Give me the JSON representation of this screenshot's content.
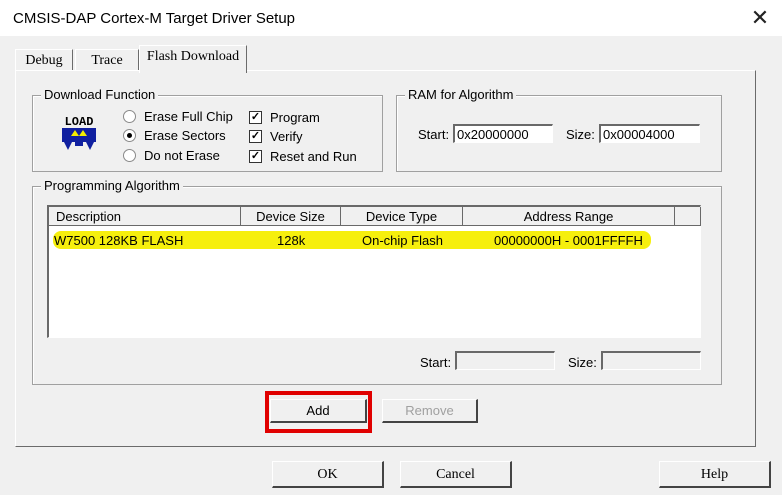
{
  "window": {
    "title": "CMSIS-DAP Cortex-M Target Driver Setup",
    "close_glyph": "✕"
  },
  "tabs": [
    {
      "label": "Debug"
    },
    {
      "label": "Trace"
    },
    {
      "label": "Flash Download",
      "active": true
    }
  ],
  "download_function": {
    "legend": "Download Function",
    "icon": "load-icon",
    "radios": [
      {
        "label": "Erase Full Chip",
        "checked": false
      },
      {
        "label": "Erase Sectors",
        "checked": true
      },
      {
        "label": "Do not Erase",
        "checked": false
      }
    ],
    "checks": [
      {
        "label": "Program",
        "checked": true
      },
      {
        "label": "Verify",
        "checked": true
      },
      {
        "label": "Reset and Run",
        "checked": true
      }
    ]
  },
  "ram": {
    "legend": "RAM for Algorithm",
    "start_label": "Start:",
    "start_value": "0x20000000",
    "size_label": "Size:",
    "size_value": "0x00004000"
  },
  "programming": {
    "legend": "Programming Algorithm",
    "columns": [
      "Description",
      "Device Size",
      "Device Type",
      "Address Range"
    ],
    "rows": [
      {
        "description": "W7500 128KB FLASH",
        "size": "128k",
        "type": "On-chip Flash",
        "range": "00000000H - 0001FFFFH",
        "highlight_color": "#f5ee00"
      }
    ],
    "start_label": "Start:",
    "start_value": "",
    "size_label": "Size:",
    "size_value": ""
  },
  "buttons": {
    "add": "Add",
    "remove": "Remove",
    "ok": "OK",
    "cancel": "Cancel",
    "help": "Help"
  },
  "colors": {
    "annotation_box": "#e00000",
    "highlight": "#f5ee00"
  }
}
